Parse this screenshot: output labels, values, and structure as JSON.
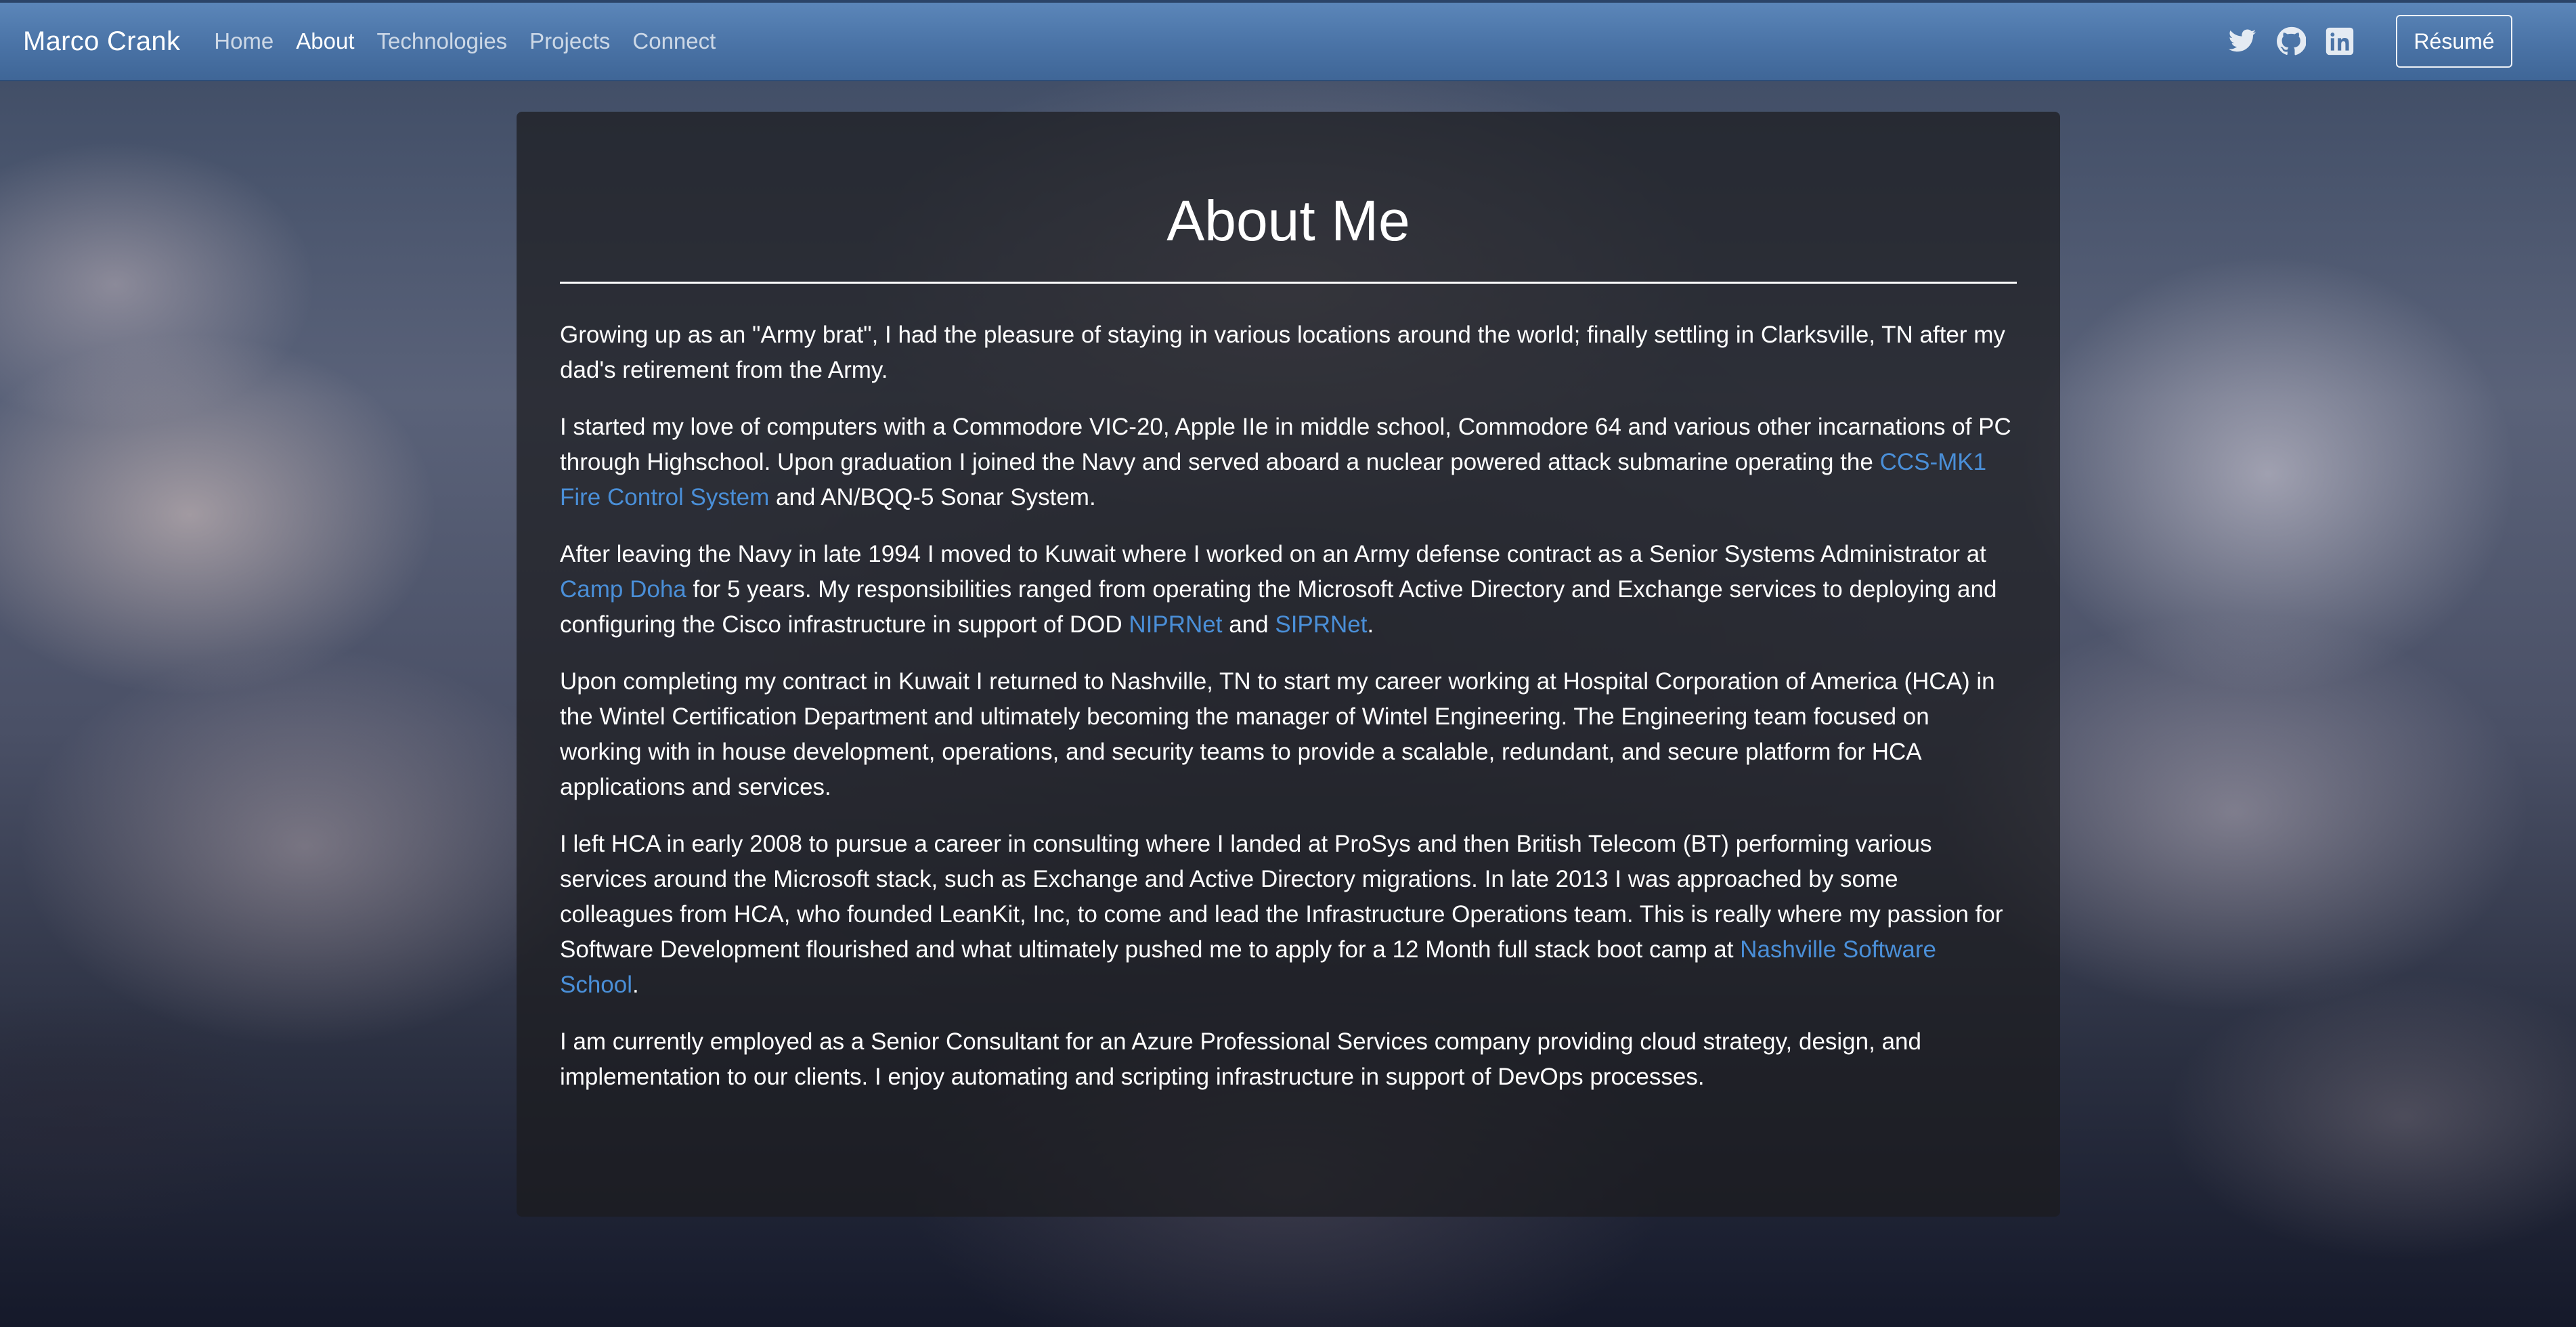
{
  "navbar": {
    "brand": "Marco Crank",
    "links": [
      "Home",
      "About",
      "Technologies",
      "Projects",
      "Connect"
    ],
    "active": "About",
    "social_icons": [
      "twitter-icon",
      "github-icon",
      "linkedin-icon"
    ],
    "resume_label": "Résumé"
  },
  "about": {
    "title": "About Me",
    "p1": "Growing up as an \"Army brat\", I had the pleasure of staying in various locations around the world; finally settling in Clarksville, TN after my dad's retirement from the Army.",
    "p2": {
      "a": "I started my love of computers with a Commodore VIC-20, Apple IIe in middle school, Commodore 64 and various other incarnations of PC through Highschool. Upon graduation I joined the Navy and served aboard a nuclear powered attack submarine operating the ",
      "link": "CCS-MK1 Fire Control System",
      "b": " and AN/BQQ-5 Sonar System."
    },
    "p3": {
      "a": "After leaving the Navy in late 1994 I moved to Kuwait where I worked on an Army defense contract as a Senior Systems Administrator at ",
      "link1": "Camp Doha",
      "b": " for 5 years. My responsibilities ranged from operating the Microsoft Active Directory and Exchange services to deploying and configuring the Cisco infrastructure in support of DOD ",
      "link2": "NIPRNet",
      "c": " and ",
      "link3": "SIPRNet",
      "d": "."
    },
    "p4": "Upon completing my contract in Kuwait I returned to Nashville, TN to start my career working at Hospital Corporation of America (HCA) in the Wintel Certification Department and ultimately becoming the manager of Wintel Engineering. The Engineering team focused on working with in house development, operations, and security teams to provide a scalable, redundant, and secure platform for HCA applications and services.",
    "p5": {
      "a": "I left HCA in early 2008 to pursue a career in consulting where I landed at ProSys and then British Telecom (BT) performing various services around the Microsoft stack, such as Exchange and Active Directory migrations. In late 2013 I was approached by some colleagues from HCA, who founded LeanKit, Inc, to come and lead the Infrastructure Operations team. This is really where my passion for Software Development flourished and what ultimately pushed me to apply for a 12 Month full stack boot camp at ",
      "link": "Nashville Software School",
      "b": "."
    },
    "p6": "I am currently employed as a Senior Consultant for an Azure Professional Services company providing cloud strategy, design, and implementation to our clients. I enjoy automating and scripting infrastructure in support of DevOps processes."
  },
  "colors": {
    "navbar": "#4a73a6",
    "link": "#4a8fd8",
    "card": "rgba(28,28,30,0.72)"
  }
}
